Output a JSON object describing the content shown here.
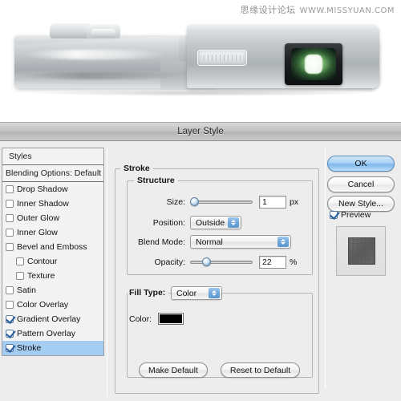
{
  "photo": {
    "watermark_cn": "思缘设计论坛",
    "watermark_url": "WWW.MISSYUAN.COM",
    "subject": "silver-digital-camera"
  },
  "dialog": {
    "title": "Layer Style"
  },
  "styles_panel": {
    "header": "Styles",
    "blending_options": "Blending Options: Default",
    "items": [
      {
        "label": "Drop Shadow",
        "checked": false,
        "sub": false,
        "selected": false
      },
      {
        "label": "Inner Shadow",
        "checked": false,
        "sub": false,
        "selected": false
      },
      {
        "label": "Outer Glow",
        "checked": false,
        "sub": false,
        "selected": false
      },
      {
        "label": "Inner Glow",
        "checked": false,
        "sub": false,
        "selected": false
      },
      {
        "label": "Bevel and Emboss",
        "checked": false,
        "sub": false,
        "selected": false
      },
      {
        "label": "Contour",
        "checked": false,
        "sub": true,
        "selected": false
      },
      {
        "label": "Texture",
        "checked": false,
        "sub": true,
        "selected": false
      },
      {
        "label": "Satin",
        "checked": false,
        "sub": false,
        "selected": false
      },
      {
        "label": "Color Overlay",
        "checked": false,
        "sub": false,
        "selected": false
      },
      {
        "label": "Gradient Overlay",
        "checked": true,
        "sub": false,
        "selected": false
      },
      {
        "label": "Pattern Overlay",
        "checked": true,
        "sub": false,
        "selected": false
      },
      {
        "label": "Stroke",
        "checked": true,
        "sub": false,
        "selected": true
      }
    ]
  },
  "settings": {
    "group_stroke": "Stroke",
    "group_structure": "Structure",
    "group_filltype": "Fill Type:",
    "size": {
      "label": "Size:",
      "value": "1",
      "unit": "px",
      "slider_percent": 2
    },
    "position": {
      "label": "Position:",
      "value": "Outside"
    },
    "blend_mode": {
      "label": "Blend Mode:",
      "value": "Normal"
    },
    "opacity": {
      "label": "Opacity:",
      "value": "22",
      "unit": "%",
      "slider_percent": 22
    },
    "fill_type": {
      "label": "Fill Type:",
      "value": "Color"
    },
    "color": {
      "label": "Color:",
      "swatch_hex": "#000000"
    },
    "make_default": "Make Default",
    "reset_to_default": "Reset to Default"
  },
  "right_buttons": {
    "ok": "OK",
    "cancel": "Cancel",
    "new_style": "New Style...",
    "preview_label": "Preview",
    "preview_checked": true
  },
  "colors": {
    "dialog_bg": "#ededed",
    "titlebar": "#c2c2c2",
    "selection_blue": "#a5cdf2",
    "accent_blue": "#6ea6d8",
    "swatch": "#000000"
  }
}
